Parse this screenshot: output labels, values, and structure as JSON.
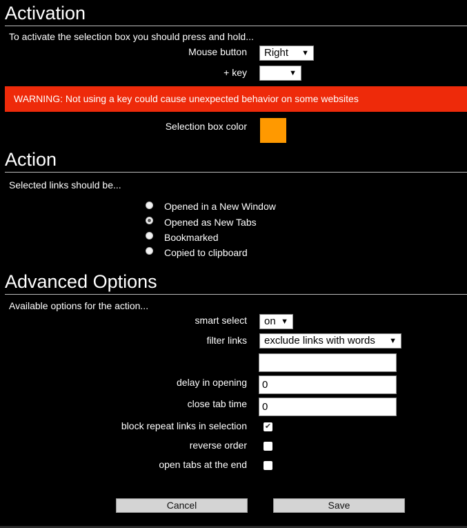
{
  "activation": {
    "title": "Activation",
    "intro": "To activate the selection box you should press and hold...",
    "mouse_button_label": "Mouse button",
    "mouse_button_value": "Right",
    "key_label": "+ key",
    "key_value": "",
    "warning": "WARNING: Not using a key could cause unexpected behavior on some websites",
    "color_label": "Selection box color",
    "color_value": "#ff9900"
  },
  "action": {
    "title": "Action",
    "intro": "Selected links should be...",
    "options": [
      {
        "label": "Opened in a New Window",
        "selected": false
      },
      {
        "label": "Opened as New Tabs",
        "selected": true
      },
      {
        "label": "Bookmarked",
        "selected": false
      },
      {
        "label": "Copied to clipboard",
        "selected": false
      }
    ]
  },
  "advanced": {
    "title": "Advanced Options",
    "intro": "Available options for the action...",
    "smart_select_label": "smart select",
    "smart_select_value": "on",
    "filter_links_label": "filter links",
    "filter_links_value": "exclude links with words",
    "filter_words_value": "",
    "delay_label": "delay in opening",
    "delay_value": "0",
    "close_tab_label": "close tab time",
    "close_tab_value": "0",
    "block_repeat_label": "block repeat links in selection",
    "block_repeat_checked": true,
    "reverse_order_label": "reverse order",
    "reverse_order_checked": false,
    "open_at_end_label": "open tabs at the end",
    "open_at_end_checked": false
  },
  "buttons": {
    "cancel": "Cancel",
    "save": "Save"
  },
  "icons": {
    "dropdown": "triangle-down-icon",
    "check": "checkmark-icon"
  }
}
